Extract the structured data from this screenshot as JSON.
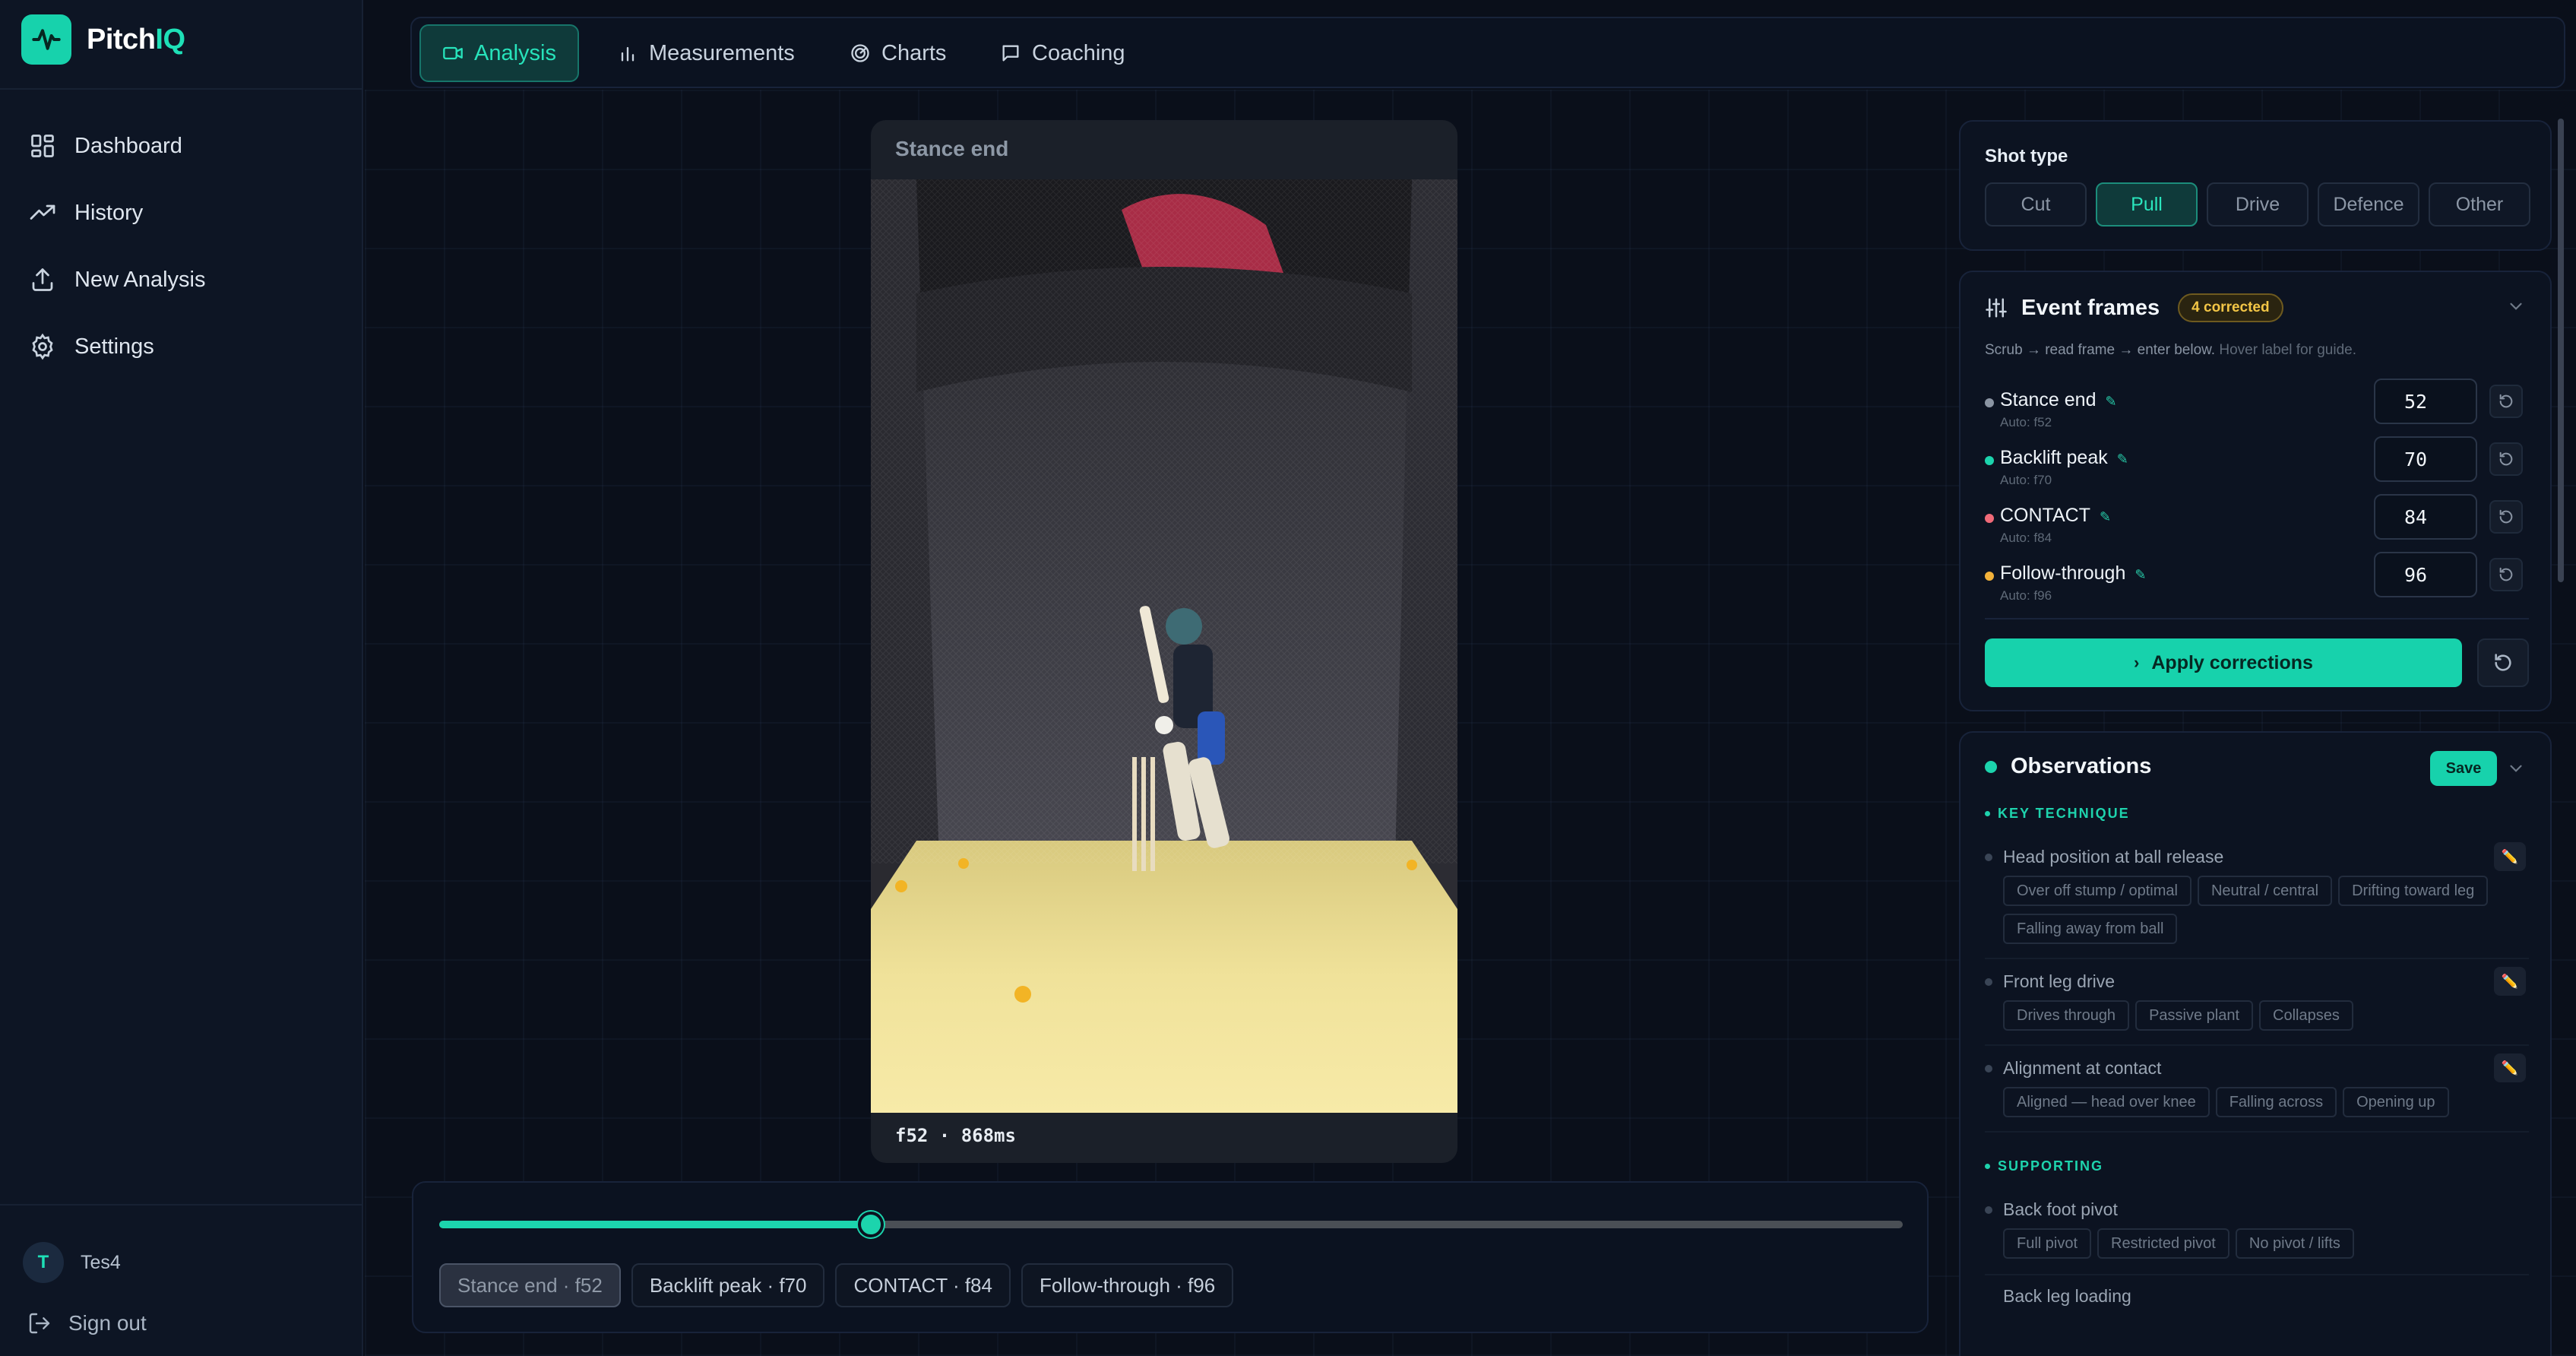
{
  "app": {
    "brand_prefix": "Pitch",
    "brand_accent": "IQ",
    "accent_color": "#17d2ac"
  },
  "sidebar": {
    "items": [
      {
        "label": "Dashboard",
        "icon": "dashboard-grid-icon"
      },
      {
        "label": "History",
        "icon": "trend-up-icon"
      },
      {
        "label": "New Analysis",
        "icon": "upload-icon"
      },
      {
        "label": "Settings",
        "icon": "gear-icon"
      }
    ],
    "user": {
      "initial": "T",
      "name": "Tes4"
    },
    "sign_out": "Sign out"
  },
  "tabs": [
    {
      "label": "Analysis",
      "icon": "video-icon",
      "active": true
    },
    {
      "label": "Measurements",
      "icon": "bar-chart-icon",
      "active": false
    },
    {
      "label": "Charts",
      "icon": "radar-icon",
      "active": false
    },
    {
      "label": "Coaching",
      "icon": "message-icon",
      "active": false
    }
  ],
  "video": {
    "title": "Stance end",
    "timestamp": "f52 · 868ms"
  },
  "timeline": {
    "progress": 0.295,
    "chips": [
      {
        "label": "Stance end · f52",
        "active": true
      },
      {
        "label": "Backlift peak · f70",
        "active": false
      },
      {
        "label": "CONTACT · f84",
        "active": false
      },
      {
        "label": "Follow-through · f96",
        "active": false
      }
    ]
  },
  "shot_type": {
    "label": "Shot type",
    "options": [
      "Cut",
      "Pull",
      "Drive",
      "Defence",
      "Other"
    ],
    "selected": "Pull"
  },
  "event_frames": {
    "title": "Event frames",
    "badge": "4 corrected",
    "hint_main": "Scrub → read frame → enter below.",
    "hint_muted": "Hover label for guide.",
    "rows": [
      {
        "name": "Stance end",
        "auto": "Auto: f52",
        "value": "52",
        "dot": "#8b95a3"
      },
      {
        "name": "Backlift peak",
        "auto": "Auto: f70",
        "value": "70",
        "dot": "#1cd4ad"
      },
      {
        "name": "CONTACT",
        "auto": "Auto: f84",
        "value": "84",
        "dot": "#f06a78"
      },
      {
        "name": "Follow-through",
        "auto": "Auto: f96",
        "value": "96",
        "dot": "#f3b23a"
      }
    ],
    "apply_label": "Apply corrections"
  },
  "observations": {
    "title": "Observations",
    "save_label": "Save",
    "sections": [
      {
        "label": "KEY TECHNIQUE",
        "questions": [
          {
            "title": "Head position at ball release",
            "options": [
              "Over off stump / optimal",
              "Neutral / central",
              "Drifting toward leg",
              "Falling away from ball"
            ]
          },
          {
            "title": "Front leg drive",
            "options": [
              "Drives through",
              "Passive plant",
              "Collapses"
            ]
          },
          {
            "title": "Alignment at contact",
            "options": [
              "Aligned — head over knee",
              "Falling across",
              "Opening up"
            ]
          }
        ]
      },
      {
        "label": "SUPPORTING",
        "questions": [
          {
            "title": "Back foot pivot",
            "options": [
              "Full pivot",
              "Restricted pivot",
              "No pivot / lifts"
            ]
          }
        ]
      }
    ],
    "cut_off_item": "Back leg loading"
  }
}
